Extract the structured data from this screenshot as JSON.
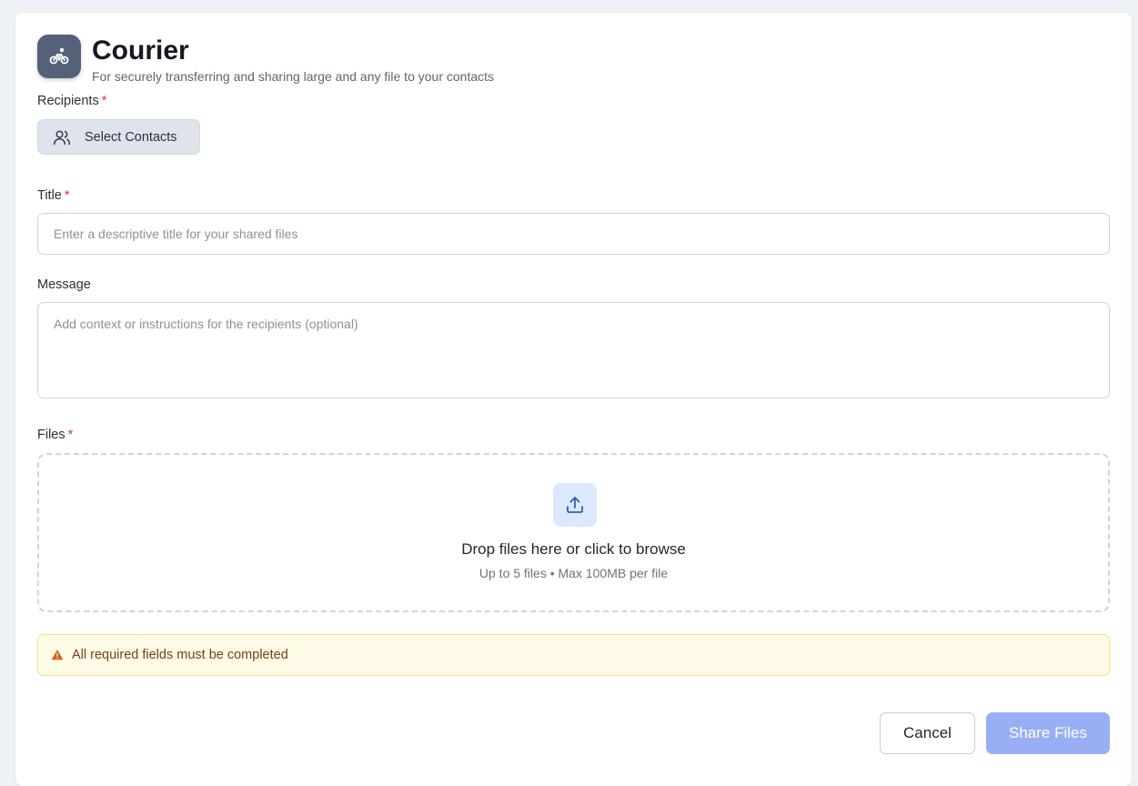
{
  "app": {
    "title": "Courier",
    "subtitle": "For securely transferring and sharing large and any file to your contacts",
    "icon": "bicycle-icon"
  },
  "recipients": {
    "label": "Recipients",
    "required_mark": "*",
    "button_label": "Select Contacts",
    "button_icon": "users-icon"
  },
  "title_field": {
    "label": "Title",
    "required_mark": "*",
    "placeholder": "Enter a descriptive title for your shared files"
  },
  "message_field": {
    "label": "Message",
    "placeholder": "Add context or instructions for the recipients (optional)"
  },
  "files": {
    "label": "Files",
    "required_mark": "*",
    "drop_title": "Drop files here or click to browse",
    "drop_hint": "Up to 5 files • Max 100MB per file",
    "icon": "upload-icon"
  },
  "alert": {
    "text": "All required fields must be completed",
    "icon": "warning-icon"
  },
  "actions": {
    "cancel_label": "Cancel",
    "share_label": "Share Files"
  },
  "colors": {
    "accent_disabled": "#98aff6",
    "required": "#d93a3a",
    "warning_bg": "#fffbe6",
    "warning_text": "#7a3f14"
  }
}
